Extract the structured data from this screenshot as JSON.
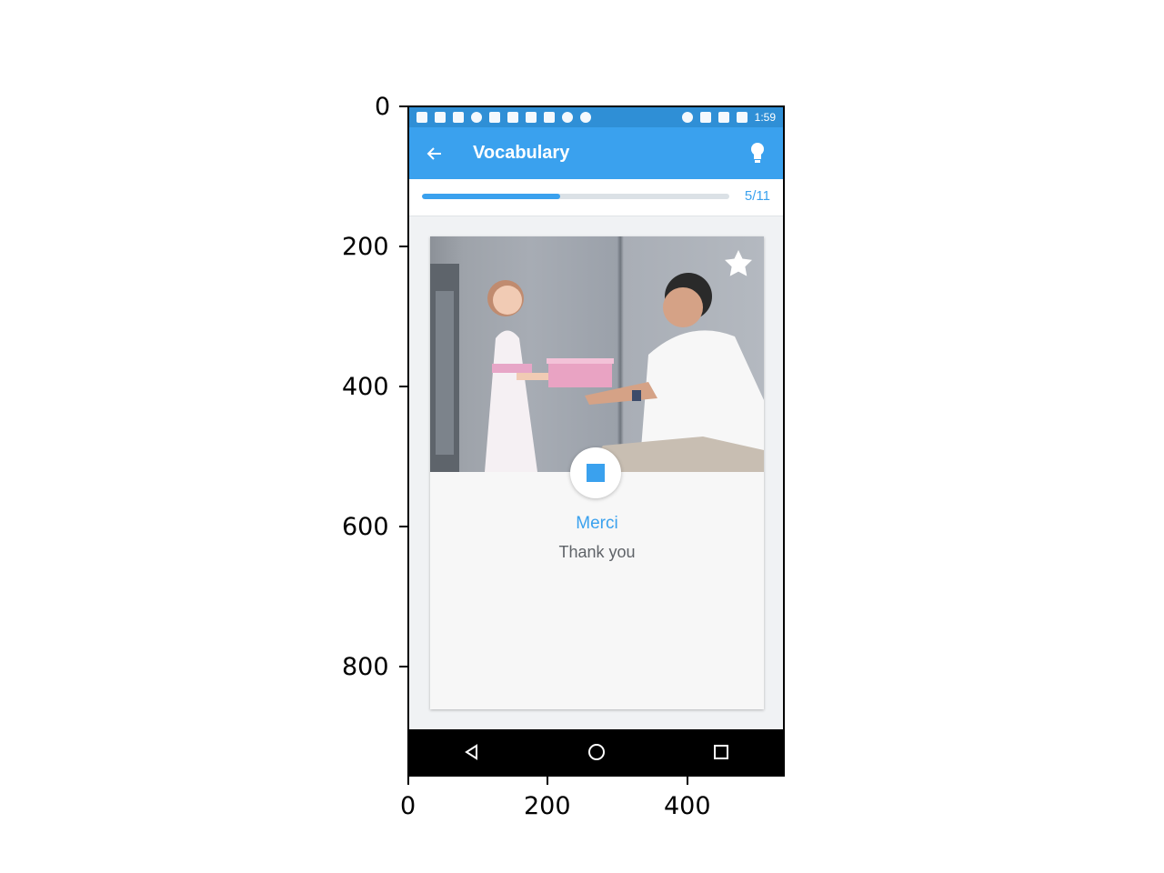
{
  "axis_ticks": {
    "y": [
      "0",
      "200",
      "400",
      "600",
      "800"
    ],
    "x": [
      "0",
      "200",
      "400"
    ]
  },
  "statusbar": {
    "time": "1:59"
  },
  "appbar": {
    "title": "Vocabulary",
    "back_icon": "arrow-left-icon",
    "hint_icon": "lightbulb-icon"
  },
  "progress": {
    "label": "5/11",
    "fraction": 0.45
  },
  "card": {
    "word": "Merci",
    "translation": "Thank you",
    "favorite_icon": "star-icon",
    "audio_icon": "stop-icon"
  },
  "navbar": {
    "back_icon": "nav-back-icon",
    "home_icon": "nav-home-icon",
    "recents_icon": "nav-recents-icon"
  },
  "colors": {
    "accent": "#3aa1ee",
    "statusbar": "#2f8fd6"
  }
}
